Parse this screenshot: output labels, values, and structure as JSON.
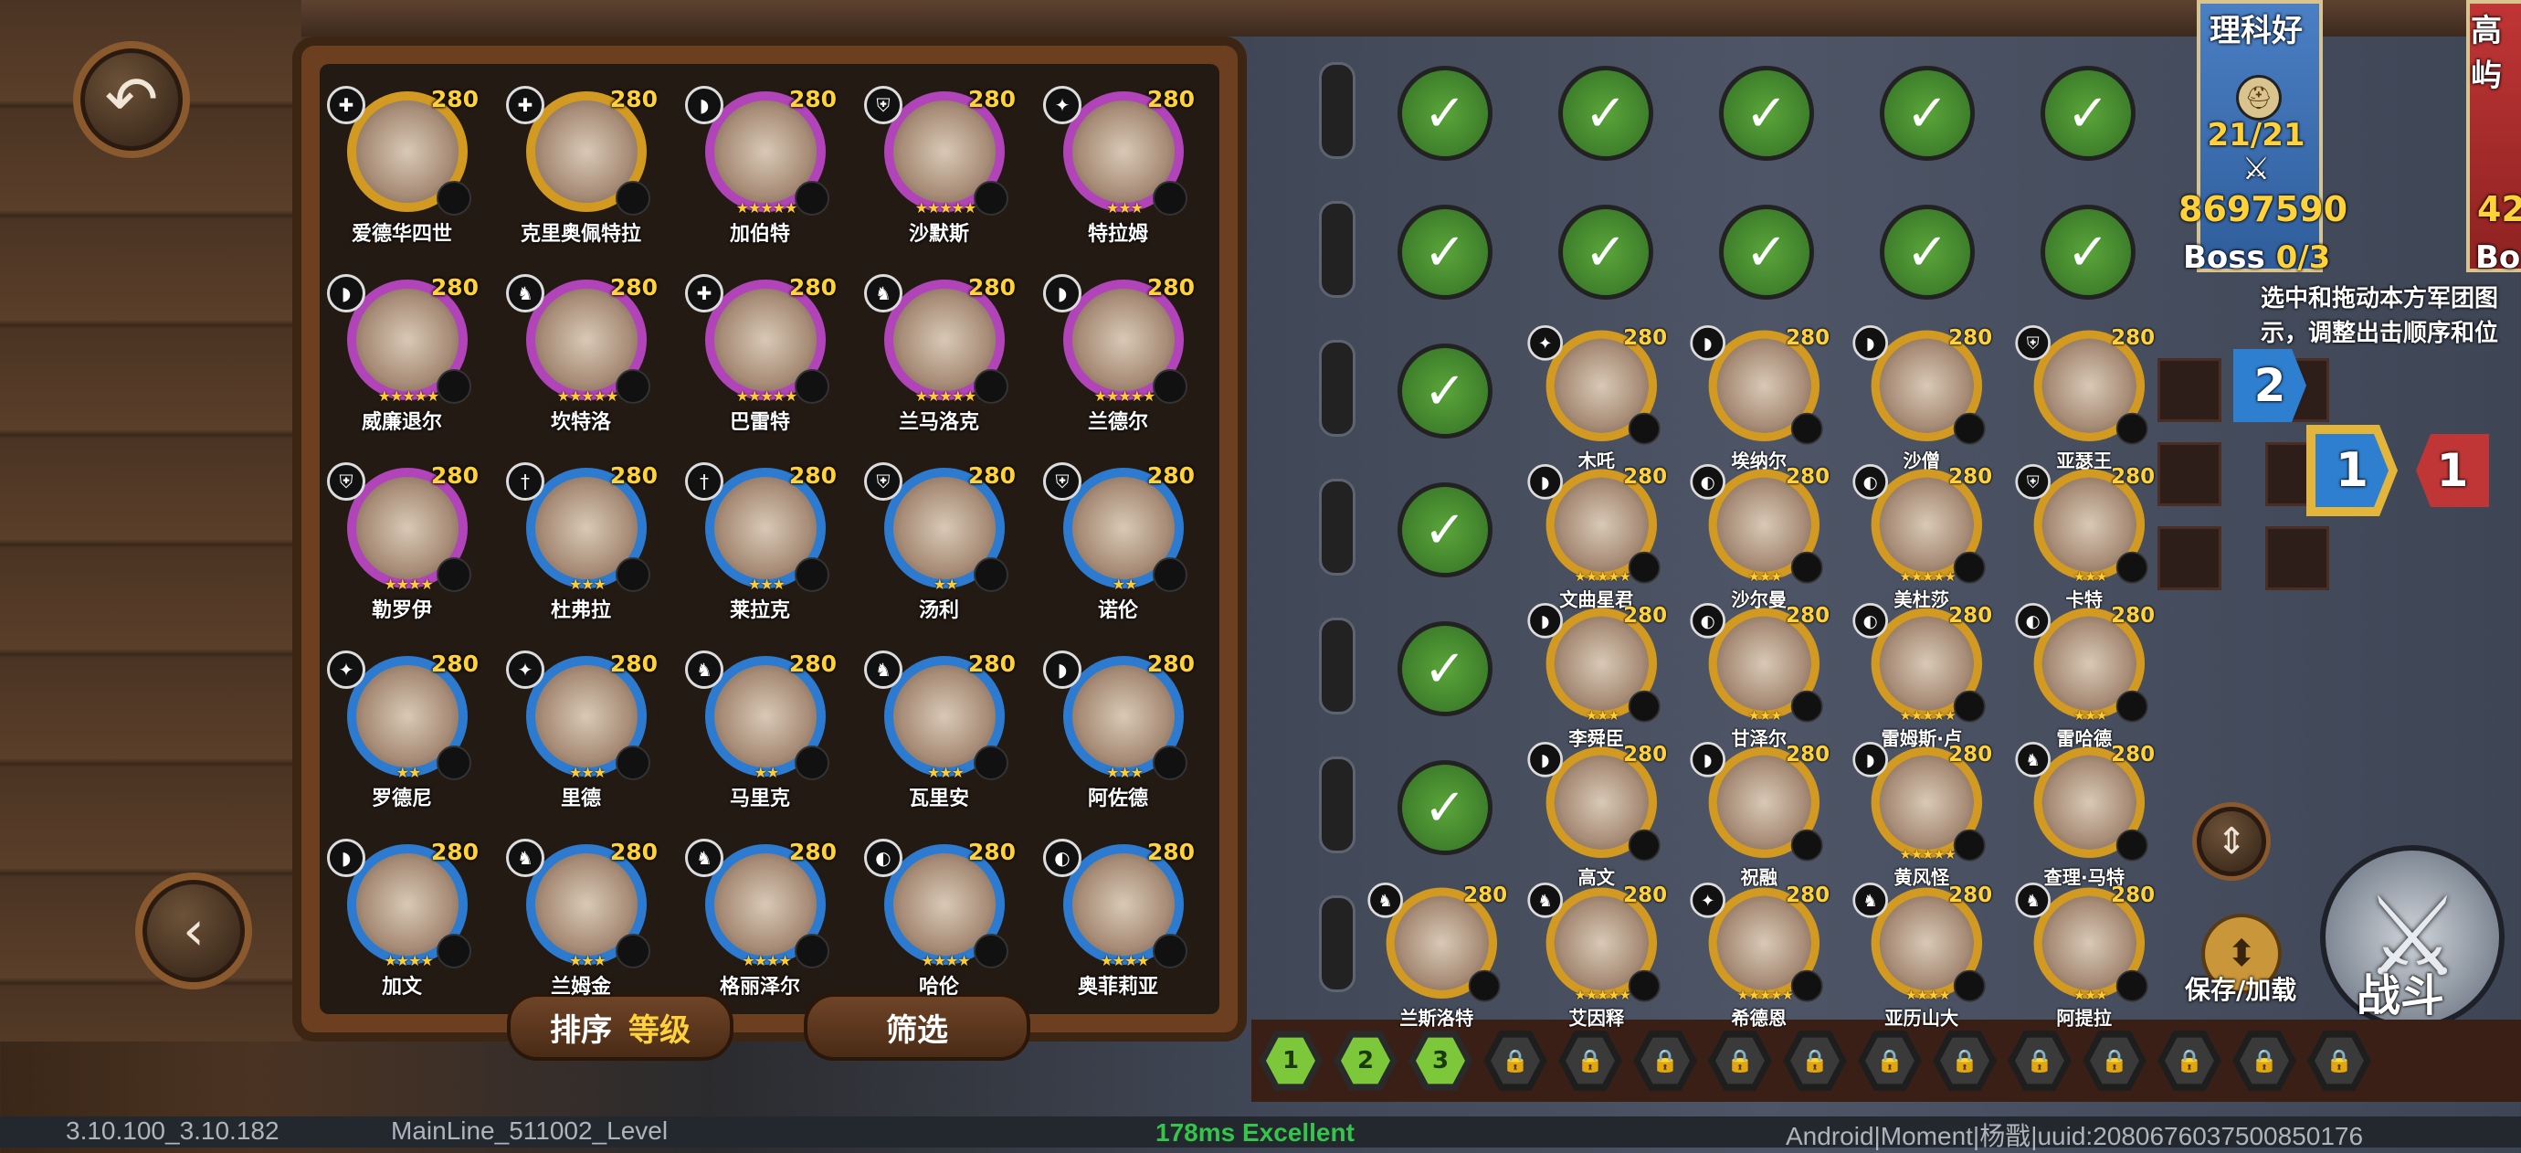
{
  "roster": {
    "heroes": [
      {
        "name": "爱德华四世",
        "level": "280",
        "cls": "✚",
        "ring": "gold",
        "stars": ""
      },
      {
        "name": "克里奥佩特拉",
        "level": "280",
        "cls": "✚",
        "ring": "gold",
        "stars": ""
      },
      {
        "name": "加伯特",
        "level": "280",
        "cls": "◗",
        "ring": "pink",
        "stars": "★★★★★"
      },
      {
        "name": "沙默斯",
        "level": "280",
        "cls": "⛨",
        "ring": "pink",
        "stars": "★★★★★"
      },
      {
        "name": "特拉姆",
        "level": "280",
        "cls": "✦",
        "ring": "pink",
        "stars": "★★★"
      },
      {
        "name": "威廉退尔",
        "level": "280",
        "cls": "◗",
        "ring": "pink",
        "stars": "★★★★★"
      },
      {
        "name": "坎特洛",
        "level": "280",
        "cls": "♞",
        "ring": "pink",
        "stars": "★★★★★"
      },
      {
        "name": "巴雷特",
        "level": "280",
        "cls": "✚",
        "ring": "pink",
        "stars": "★★★★★"
      },
      {
        "name": "兰马洛克",
        "level": "280",
        "cls": "♞",
        "ring": "pink",
        "stars": "★★★★★"
      },
      {
        "name": "兰德尔",
        "level": "280",
        "cls": "◗",
        "ring": "pink",
        "stars": "★★★★★"
      },
      {
        "name": "勒罗伊",
        "level": "280",
        "cls": "⛨",
        "ring": "pink",
        "stars": "★★★★"
      },
      {
        "name": "杜弗拉",
        "level": "280",
        "cls": "†",
        "ring": "blue",
        "stars": "★★★"
      },
      {
        "name": "莱拉克",
        "level": "280",
        "cls": "†",
        "ring": "blue",
        "stars": "★★★"
      },
      {
        "name": "汤利",
        "level": "280",
        "cls": "⛨",
        "ring": "blue",
        "stars": "★★"
      },
      {
        "name": "诺伦",
        "level": "280",
        "cls": "⛨",
        "ring": "blue",
        "stars": "★★"
      },
      {
        "name": "罗德尼",
        "level": "280",
        "cls": "✦",
        "ring": "blue",
        "stars": "★★"
      },
      {
        "name": "里德",
        "level": "280",
        "cls": "✦",
        "ring": "blue",
        "stars": "★★★"
      },
      {
        "name": "马里克",
        "level": "280",
        "cls": "♞",
        "ring": "blue",
        "stars": "★★"
      },
      {
        "name": "瓦里安",
        "level": "280",
        "cls": "♞",
        "ring": "blue",
        "stars": "★★★"
      },
      {
        "name": "阿佐德",
        "level": "280",
        "cls": "◗",
        "ring": "blue",
        "stars": "★★★"
      },
      {
        "name": "加文",
        "level": "280",
        "cls": "◗",
        "ring": "blue",
        "stars": "★★★★"
      },
      {
        "name": "兰姆金",
        "level": "280",
        "cls": "♞",
        "ring": "blue",
        "stars": "★★★"
      },
      {
        "name": "格丽泽尔",
        "level": "280",
        "cls": "♞",
        "ring": "blue",
        "stars": "★★★★"
      },
      {
        "name": "哈伦",
        "level": "280",
        "cls": "◐",
        "ring": "blue",
        "stars": "★★★★"
      },
      {
        "name": "奥菲莉亚",
        "level": "280",
        "cls": "◐",
        "ring": "blue",
        "stars": "★★★★"
      }
    ],
    "sort_label": "排序",
    "sort_value": "等级",
    "filter_label": "筛选"
  },
  "army": {
    "heroes": [
      {
        "name": "木吒",
        "level": "280",
        "cls": "✦",
        "stars": ""
      },
      {
        "name": "埃纳尔",
        "level": "280",
        "cls": "◗",
        "stars": ""
      },
      {
        "name": "沙僧",
        "level": "280",
        "cls": "◗",
        "stars": ""
      },
      {
        "name": "亚瑟王",
        "level": "280",
        "cls": "⛨",
        "stars": ""
      },
      {
        "name": "文曲星君",
        "level": "280",
        "cls": "◗",
        "stars": "★★★★★"
      },
      {
        "name": "沙尔曼",
        "level": "280",
        "cls": "◐",
        "stars": "★★★"
      },
      {
        "name": "美杜莎",
        "level": "280",
        "cls": "◐",
        "stars": "★★★★★"
      },
      {
        "name": "卡特",
        "level": "280",
        "cls": "⛨",
        "stars": "★★★"
      },
      {
        "name": "李舜臣",
        "level": "280",
        "cls": "◗",
        "stars": "★★★"
      },
      {
        "name": "甘泽尔",
        "level": "280",
        "cls": "◐",
        "stars": "★★★"
      },
      {
        "name": "雷姆斯·卢",
        "level": "280",
        "cls": "◐",
        "stars": "★★★★★"
      },
      {
        "name": "雷哈德",
        "level": "280",
        "cls": "◐",
        "stars": "★★★"
      },
      {
        "name": "高文",
        "level": "280",
        "cls": "◗",
        "stars": ""
      },
      {
        "name": "祝融",
        "level": "280",
        "cls": "◗",
        "stars": ""
      },
      {
        "name": "黄风怪",
        "level": "280",
        "cls": "◗",
        "stars": "★★★★★"
      },
      {
        "name": "查理·马特",
        "level": "280",
        "cls": "♞",
        "stars": ""
      },
      {
        "name": "兰斯洛特",
        "level": "280",
        "cls": "♞",
        "stars": ""
      },
      {
        "name": "艾因释",
        "level": "280",
        "cls": "♞",
        "stars": "★★★★★"
      },
      {
        "name": "希德恩",
        "level": "280",
        "cls": "✦",
        "stars": "★★★★★"
      },
      {
        "name": "亚历山大",
        "level": "280",
        "cls": "♞",
        "stars": "★★★★"
      },
      {
        "name": "阿提拉",
        "level": "280",
        "cls": "♞",
        "stars": "★★★"
      }
    ]
  },
  "team": {
    "banner_title": "理科好",
    "banner_title2": "高屿",
    "unit_count": "21/21",
    "power": "8697590",
    "power2": "42",
    "boss_label": "Boss",
    "boss_value": "0/3",
    "boss2": "Bo",
    "hint": "选中和拖动本方军团图示，调整出击顺序和位置",
    "order_badges": [
      "2",
      "1",
      "1"
    ],
    "save_load_label": "保存/加载",
    "battle_label": "战斗"
  },
  "waves": {
    "unlocked": [
      "1",
      "2",
      "3"
    ],
    "locked_count": 12
  },
  "footer": {
    "version": "3.10.100_3.10.182",
    "level": "MainLine_511002_Level",
    "ping": "178ms Excellent",
    "device": "Android|Moment|杨戬|uuid:2080676037500850176"
  },
  "colors": {
    "level": "#ffd23a",
    "ping": "#35c54a",
    "check": "#4d9b33"
  }
}
